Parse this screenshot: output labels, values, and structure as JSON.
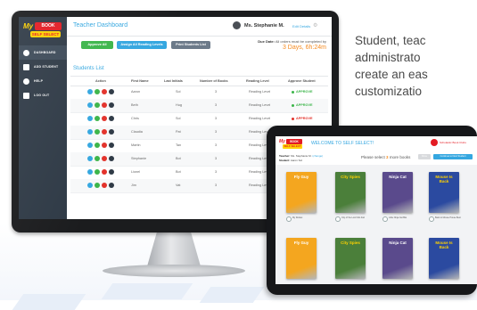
{
  "colors": {
    "accent": "#35a7e0",
    "approve": "#3cb54a",
    "revoke": "#e3322b",
    "due": "#f58a1f",
    "sidebar": "#2f3a46"
  },
  "tagline": [
    "Student, teac",
    "administrato",
    "create an eas",
    "customizatio"
  ],
  "dashboard": {
    "logo": {
      "my": "My",
      "book": "BOOK",
      "sub": "SELF SELECT"
    },
    "sidebar": [
      {
        "label": "DASHBOARD",
        "icon": "dashboard-icon"
      },
      {
        "label": "ADD STUDENT",
        "icon": "add-user-icon"
      },
      {
        "label": "HELP",
        "icon": "help-icon"
      },
      {
        "label": "LOG OUT",
        "icon": "logout-icon"
      }
    ],
    "header": {
      "title": "Teacher Dashboard",
      "user": "Ms. Stephanie M.",
      "edit": "Edit Details"
    },
    "toolbar": {
      "approve_all": "Approve All",
      "assign_levels": "Assign All Reading Levels",
      "print_list": "Print Students List"
    },
    "due": {
      "label": "Due Date:",
      "text": "All orders must be completed by",
      "countdown": "3 Days, 6h:24m"
    },
    "students_title": "Students List",
    "columns": [
      "Action",
      "First Name",
      "Last Initials",
      "Number of Books",
      "Reading Level",
      "Approve Student"
    ],
    "rows": [
      {
        "first": "Aaron",
        "last": "Sol",
        "books": "3",
        "level": "Reading Level",
        "status": "APPROVE",
        "state": "approve"
      },
      {
        "first": "Beth",
        "last": "Hug",
        "books": "3",
        "level": "Reading Level",
        "status": "APPROVE",
        "state": "approve"
      },
      {
        "first": "Chris",
        "last": "Sol",
        "books": "3",
        "level": "Reading Level",
        "status": "APPROVE",
        "state": "revoke"
      },
      {
        "first": "Claudia",
        "last": "Pat",
        "books": "3",
        "level": "Reading Level",
        "status": "APPROVE",
        "state": "revoke"
      },
      {
        "first": "Martin",
        "last": "Tan",
        "books": "3",
        "level": "Reading Level",
        "status": "APPROVE",
        "state": "approve"
      },
      {
        "first": "Stephanie",
        "last": "Bot",
        "books": "3",
        "level": "Reading Level",
        "status": "APPROVE",
        "state": "approve"
      },
      {
        "first": "Lionel",
        "last": "Bot",
        "books": "3",
        "level": "Reading Level",
        "status": "APPROVE",
        "state": "approve"
      },
      {
        "first": "Jim",
        "last": "Vat",
        "books": "3",
        "level": "Reading Level",
        "status": "APPROVE",
        "state": "approve"
      }
    ]
  },
  "tablet": {
    "logo": {
      "my": "My",
      "book": "BOOK",
      "sub": "SELF SELECT"
    },
    "title": "WELCOME TO SELF SELECT!",
    "school": "Scholastic Book Clubs",
    "teacher_label": "Teacher:",
    "teacher_name": "Ms. Stephanie M.",
    "teacher_link": "(change)",
    "student_label": "Student:",
    "student_name": "Aaron Sol",
    "prompt_pre": "Please select",
    "prompt_count": "3",
    "prompt_post": "more books",
    "btn_done": "Done",
    "btn_continue": "Continue to Next Student",
    "books": [
      {
        "title": "Fly Guy",
        "caption": "My Rocket",
        "cover": "#f4a61f",
        "textcolor": "#ffffff"
      },
      {
        "title": "City Spies",
        "caption": "City of the Lost Kids Fair",
        "cover": "#4b7f3a",
        "textcolor": "#ffd200"
      },
      {
        "title": "Ninja Cat",
        "caption": "Little Ninja Cat Bks",
        "cover": "#5a4a8c",
        "textcolor": "#ffffff"
      },
      {
        "title": "Mouse Is Back",
        "caption": "Back to Mouse House Best",
        "cover": "#2b4aa0",
        "textcolor": "#ffd200"
      },
      {
        "title": "Fly Guy",
        "caption": "",
        "cover": "#f4a61f",
        "textcolor": "#ffffff"
      },
      {
        "title": "City Spies",
        "caption": "",
        "cover": "#4b7f3a",
        "textcolor": "#ffd200"
      },
      {
        "title": "Ninja Cat",
        "caption": "",
        "cover": "#5a4a8c",
        "textcolor": "#ffffff"
      },
      {
        "title": "Mouse Is Back",
        "caption": "",
        "cover": "#2b4aa0",
        "textcolor": "#ffd200"
      }
    ]
  }
}
